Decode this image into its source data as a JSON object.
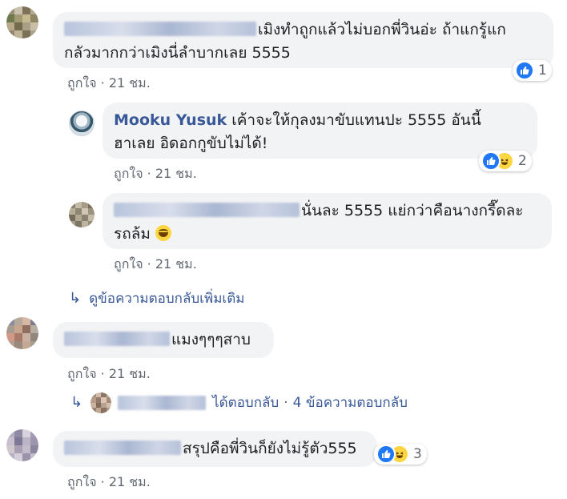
{
  "comments": [
    {
      "text": "เมิงทำถูกแล้วไม่บอกพี่วินอ่ะ ถ้าแกรู้แก",
      "text2": "กลัวมากกว่าเมิงนี่ลำบากเลย 5555",
      "reaction_count": "1",
      "like_label": "ถูกใจ",
      "time": "21 ชม."
    },
    {
      "author": "Mooku Yusuk",
      "text": " เค้าจะให้กุลงมาขับแทนปะ 5555 อันนี้",
      "text2": "ฮาเลย อิดอกกูขับไม่ได้!",
      "reaction_count": "2",
      "like_label": "ถูกใจ",
      "time": "21 ชม."
    },
    {
      "text": "นั่นละ 5555 แย่กว่าคือนางกรี๊ดละ",
      "text2": "รถล้ม",
      "like_label": "ถูกใจ",
      "time": "21 ชม."
    },
    {
      "text": "แมงๆๆๆสาบ",
      "like_label": "ถูกใจ",
      "time": "21 ชม."
    },
    {
      "text": "สรุปคือพี่วินก็ยังไม่รู้ตัว555",
      "reaction_count": "3",
      "like_label": "ถูกใจ",
      "time": "21 ชม."
    }
  ],
  "view_more_replies": "ดูข้อความตอบกลับเพิ่มเติม",
  "replied_summary": {
    "action": "ได้ตอบกลับ",
    "separator": "·",
    "count": "4 ข้อความตอบกลับ"
  },
  "separator_dot": "·",
  "colors": {
    "link": "#385898",
    "bubble": "#f2f3f5",
    "meta": "#606770",
    "like_reaction": "#2078f4",
    "haha_reaction": "#fcd640"
  },
  "icons": [
    "like-reaction-icon",
    "haha-reaction-icon",
    "laughing-emoji-icon",
    "reply-arrow-icon"
  ]
}
